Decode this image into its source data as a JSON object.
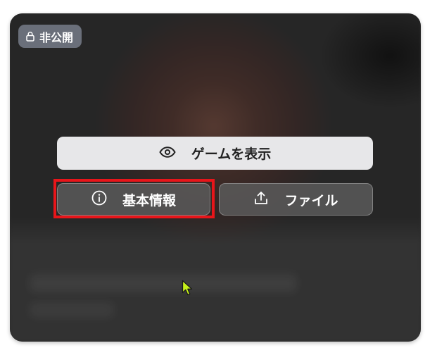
{
  "badge": {
    "icon": "lock-icon",
    "label": "非公開"
  },
  "buttons": {
    "view_game": {
      "icon": "eye-icon",
      "label": "ゲームを表示"
    },
    "basic_info": {
      "icon": "info-circle-icon",
      "label": "基本情報"
    },
    "files": {
      "icon": "upload-icon",
      "label": "ファイル"
    }
  },
  "colors": {
    "highlight": "#e8151a",
    "cursor": "#c6f01a",
    "badge_bg": "#6a6f7a",
    "primary_button_bg": "#e7e7e9"
  }
}
